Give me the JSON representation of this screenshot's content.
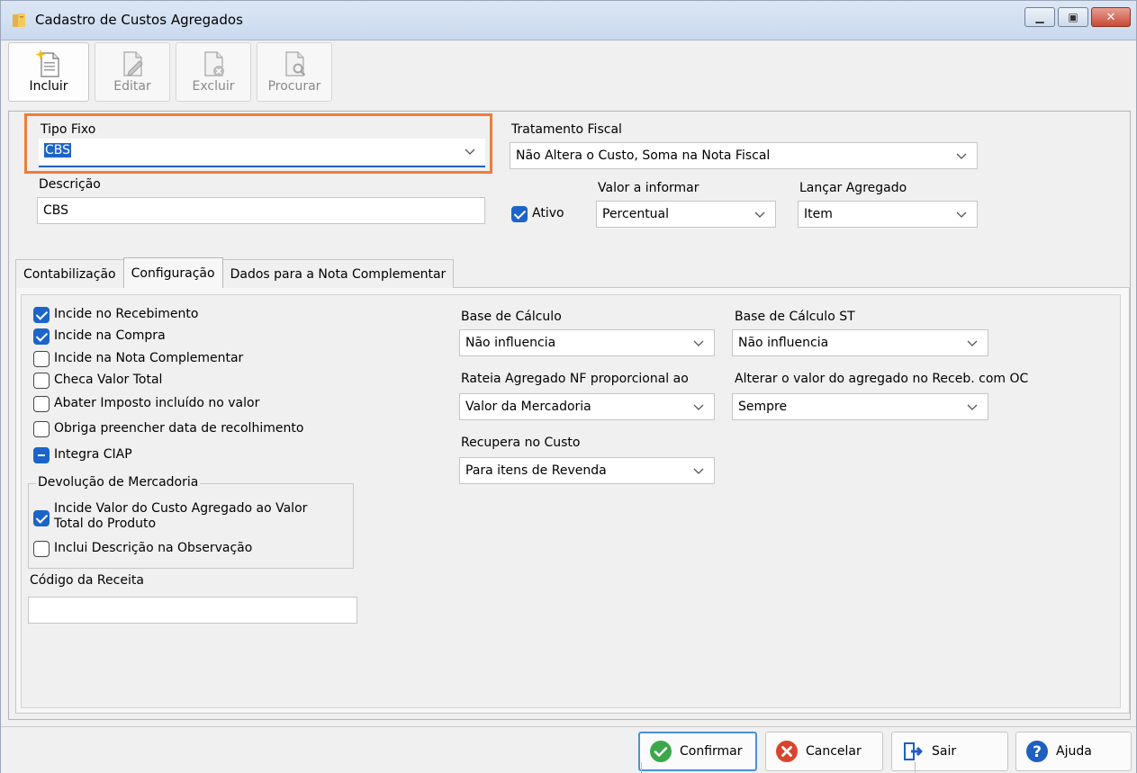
{
  "window": {
    "title": "Cadastro de Custos Agregados",
    "controls": [
      "minimize",
      "maximize",
      "close"
    ]
  },
  "toolbar": {
    "buttons": [
      {
        "label": "Incluir",
        "icon": "new-document-icon",
        "enabled": true
      },
      {
        "label": "Editar",
        "icon": "edit-document-icon",
        "enabled": false
      },
      {
        "label": "Excluir",
        "icon": "delete-document-icon",
        "enabled": false
      },
      {
        "label": "Procurar",
        "icon": "search-document-icon",
        "enabled": false
      }
    ]
  },
  "form": {
    "tipo_fixo": {
      "label": "Tipo Fixo",
      "value": "CBS"
    },
    "tratamento_fiscal": {
      "label": "Tratamento Fiscal",
      "value": "Não Altera o Custo, Soma na Nota Fiscal"
    },
    "descricao": {
      "label": "Descrição",
      "value": "CBS"
    },
    "ativo": {
      "label": "Ativo",
      "checked": true
    },
    "valor_a_informar": {
      "label": "Valor a informar",
      "value": "Percentual"
    },
    "lancar_agregado": {
      "label": "Lançar Agregado",
      "value": "Item"
    }
  },
  "tabs": [
    {
      "label": "Contabilização",
      "active": false
    },
    {
      "label": "Configuração",
      "active": true
    },
    {
      "label": "Dados para a Nota Complementar",
      "active": false
    }
  ],
  "config": {
    "checkboxes": [
      {
        "label": "Incide no Recebimento",
        "state": "checked"
      },
      {
        "label": "Incide na Compra",
        "state": "checked"
      },
      {
        "label": "Incide na Nota Complementar",
        "state": "unchecked"
      },
      {
        "label": "Checa Valor Total",
        "state": "unchecked"
      },
      {
        "label": "Abater Imposto incluído no valor",
        "state": "unchecked"
      },
      {
        "label": "Obriga preencher data de recolhimento",
        "state": "unchecked"
      },
      {
        "label": "Integra CIAP",
        "state": "indeterminate"
      }
    ],
    "devolucao": {
      "title": "Devolução de Mercadoria",
      "incide_valor": {
        "label_line1": "Incide Valor do Custo Agregado ao Valor",
        "label_line2": "Total do Produto",
        "state": "checked"
      },
      "inclui_descricao": {
        "label": "Inclui Descrição na Observação",
        "state": "unchecked"
      }
    },
    "codigo_receita": {
      "label": "Código da Receita",
      "value": ""
    },
    "base_calculo": {
      "label": "Base de Cálculo",
      "value": "Não influencia"
    },
    "base_calculo_st": {
      "label": "Base de Cálculo ST",
      "value": "Não influencia"
    },
    "rateia": {
      "label": "Rateia Agregado NF proporcional ao",
      "value": "Valor da Mercadoria"
    },
    "alterar_valor": {
      "label": "Alterar o valor do agregado no Receb. com OC",
      "value": "Sempre"
    },
    "recupera_custo": {
      "label": "Recupera no Custo",
      "value": "Para itens de Revenda"
    }
  },
  "footer": {
    "confirmar": "Confirmar",
    "cancelar": "Cancelar",
    "sair": "Sair",
    "ajuda": "Ajuda"
  },
  "colors": {
    "accent": "#1c64c9",
    "highlight_border": "#ee7d3a",
    "confirm_green": "#3aa84a",
    "cancel_red": "#d8452e",
    "help_blue": "#1f5fbf"
  }
}
